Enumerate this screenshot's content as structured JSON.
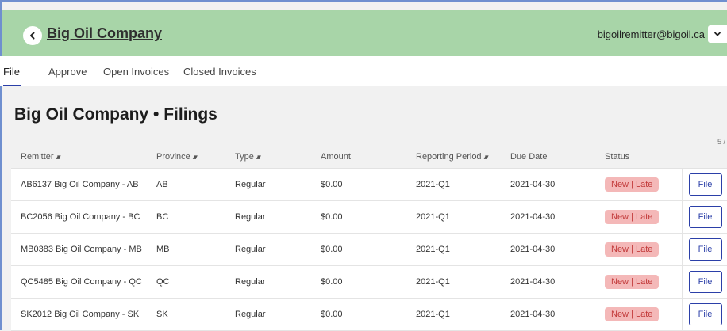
{
  "header": {
    "company": "Big Oil Company",
    "user_email": "bigoilremitter@bigoil.ca"
  },
  "tabs": [
    {
      "label": "File",
      "active": true
    },
    {
      "label": "Approve",
      "active": false
    },
    {
      "label": "Open Invoices",
      "active": false
    },
    {
      "label": "Closed Invoices",
      "active": false
    }
  ],
  "page": {
    "title": "Big Oil Company • Filings",
    "count": "5 /"
  },
  "table": {
    "columns": [
      "Remitter",
      "Province",
      "Type",
      "Amount",
      "Reporting Period",
      "Due Date",
      "Status"
    ],
    "sortable": [
      true,
      true,
      true,
      false,
      true,
      false,
      false
    ],
    "rows": [
      {
        "remitter": "AB6137 Big Oil Company - AB",
        "province": "AB",
        "type": "Regular",
        "amount": "$0.00",
        "period": "2021-Q1",
        "due": "2021-04-30",
        "status": "New | Late",
        "action": "File"
      },
      {
        "remitter": "BC2056 Big Oil Company - BC",
        "province": "BC",
        "type": "Regular",
        "amount": "$0.00",
        "period": "2021-Q1",
        "due": "2021-04-30",
        "status": "New | Late",
        "action": "File"
      },
      {
        "remitter": "MB0383 Big Oil Company - MB",
        "province": "MB",
        "type": "Regular",
        "amount": "$0.00",
        "period": "2021-Q1",
        "due": "2021-04-30",
        "status": "New | Late",
        "action": "File"
      },
      {
        "remitter": "QC5485 Big Oil Company - QC",
        "province": "QC",
        "type": "Regular",
        "amount": "$0.00",
        "period": "2021-Q1",
        "due": "2021-04-30",
        "status": "New | Late",
        "action": "File"
      },
      {
        "remitter": "SK2012 Big Oil Company - SK",
        "province": "SK",
        "type": "Regular",
        "amount": "$0.00",
        "period": "2021-Q1",
        "due": "2021-04-30",
        "status": "New | Late",
        "action": "File"
      }
    ]
  },
  "colors": {
    "header_bg": "#a8d5a8",
    "accent": "#2b3fa8",
    "status_bg": "#f4b8b8",
    "status_text": "#c23a3a"
  },
  "icons": {
    "back": "chevron-left-icon",
    "dropdown": "chevron-down-icon",
    "sort": "sort-icon"
  }
}
